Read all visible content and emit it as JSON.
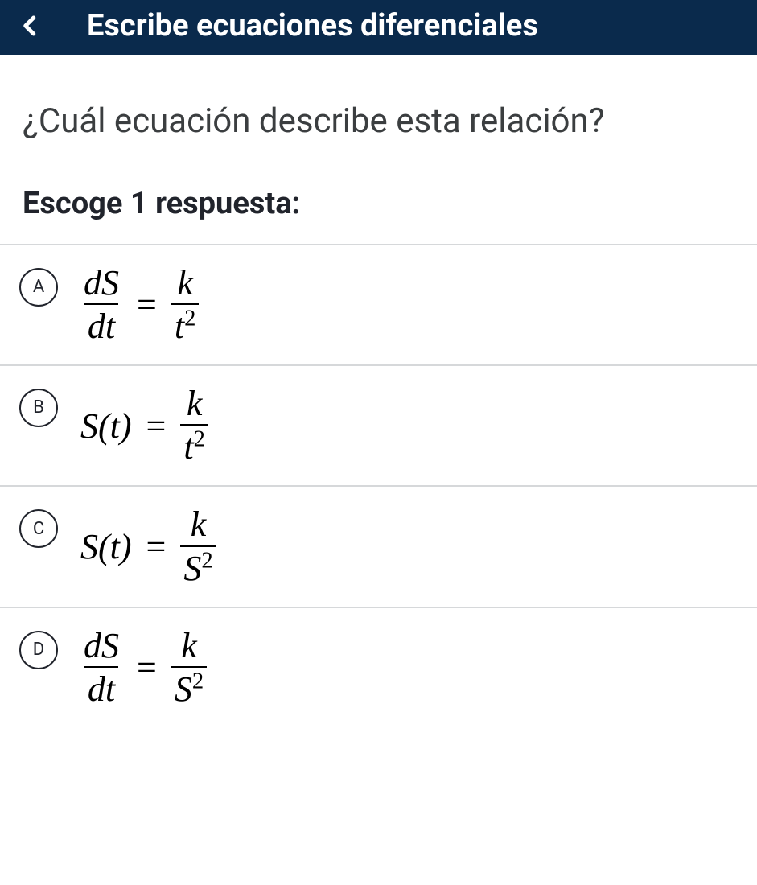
{
  "header": {
    "title": "Escribe ecuaciones diferenciales"
  },
  "question": "¿Cuál ecuación describe esta relación?",
  "instruction": "Escoge 1 respuesta:",
  "options": [
    {
      "letter": "A",
      "lhs_type": "derivative",
      "lhs_num": "dS",
      "lhs_den": "dt",
      "rhs_num": "k",
      "rhs_den_base": "t",
      "rhs_den_exp": "2"
    },
    {
      "letter": "B",
      "lhs_type": "function",
      "lhs_text": "S(t)",
      "rhs_num": "k",
      "rhs_den_base": "t",
      "rhs_den_exp": "2"
    },
    {
      "letter": "C",
      "lhs_type": "function",
      "lhs_text": "S(t)",
      "rhs_num": "k",
      "rhs_den_base": "S",
      "rhs_den_exp": "2"
    },
    {
      "letter": "D",
      "lhs_type": "derivative",
      "lhs_num": "dS",
      "lhs_den": "dt",
      "rhs_num": "k",
      "rhs_den_base": "S",
      "rhs_den_exp": "2"
    }
  ]
}
